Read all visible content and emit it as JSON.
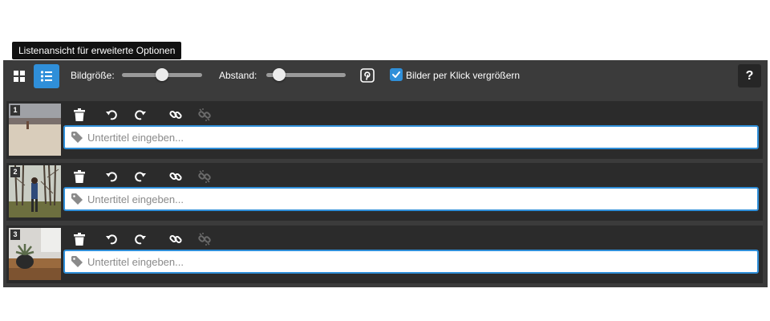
{
  "tooltip": "Listenansicht für erweiterte Optionen",
  "toolbar": {
    "image_size_label": "Bildgröße:",
    "image_size_value": 0.5,
    "spacing_label": "Abstand:",
    "spacing_value": 0.1,
    "enlarge_checkbox_label": "Bilder per Klick vergrößern",
    "enlarge_checked": true,
    "help_label": "?"
  },
  "images": [
    {
      "number": "1",
      "caption_value": "",
      "caption_placeholder": "Untertitel eingeben..."
    },
    {
      "number": "2",
      "caption_value": "",
      "caption_placeholder": "Untertitel eingeben..."
    },
    {
      "number": "3",
      "caption_value": "",
      "caption_placeholder": "Untertitel eingeben..."
    }
  ],
  "colors": {
    "accent": "#2f8fd9",
    "panel": "#3b3b3b",
    "row": "#2b2b2b"
  },
  "icons": {
    "grid_view": "grid-icon",
    "list_view": "list-icon",
    "pinterest": "pinterest-icon",
    "delete": "trash-icon",
    "rotate_left": "rotate-left-icon",
    "rotate_right": "rotate-right-icon",
    "link": "link-icon",
    "unlink": "unlink-icon",
    "tag": "tag-icon"
  }
}
